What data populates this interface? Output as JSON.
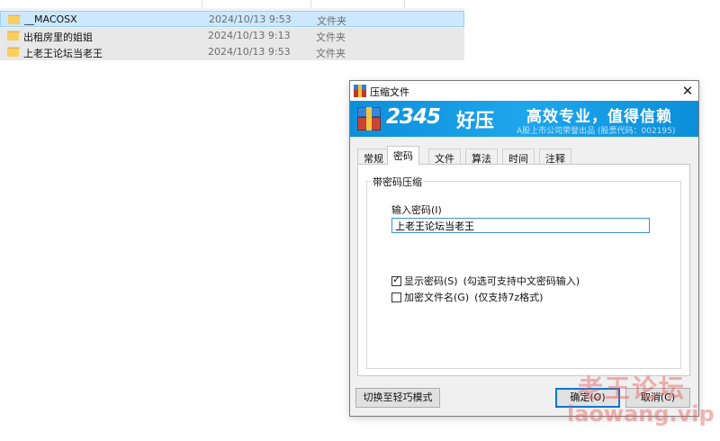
{
  "file_list": {
    "rows": [
      {
        "name": "__MACOSX",
        "date": "2024/10/13 9:53",
        "type": "文件夹",
        "selected": true
      },
      {
        "name": "出租房里的姐姐",
        "date": "2024/10/13 9:13",
        "type": "文件夹",
        "selected": false
      },
      {
        "name": "上老王论坛当老王",
        "date": "2024/10/13 9:53",
        "type": "文件夹",
        "selected": false
      }
    ]
  },
  "dialog": {
    "title": "压缩文件",
    "close_label": "✕",
    "banner": {
      "brand_number": "2345",
      "brand_name": "好压",
      "slogan": "高效专业，值得信赖",
      "subline": "A股上市公司荣誉出品 (股票代码：002195)"
    },
    "tabs": [
      "常规",
      "密码",
      "文件",
      "算法",
      "时间",
      "注释"
    ],
    "active_tab": "密码",
    "group_title": "带密码压缩",
    "password_label": "输入密码(I)",
    "password_value": "上老王论坛当老王",
    "checkboxes": [
      {
        "label": "显示密码(S)",
        "note": "(勾选可支持中文密码输入)",
        "checked": true
      },
      {
        "label": "加密文件名(G)",
        "note": "(仅支持7z格式)",
        "checked": false
      }
    ],
    "buttons": {
      "simple_mode": "切换至轻巧模式",
      "ok": "确定(O)",
      "cancel": "取消(C)"
    }
  },
  "watermark": {
    "cn": "老王论坛",
    "en": "laowang.vip"
  }
}
